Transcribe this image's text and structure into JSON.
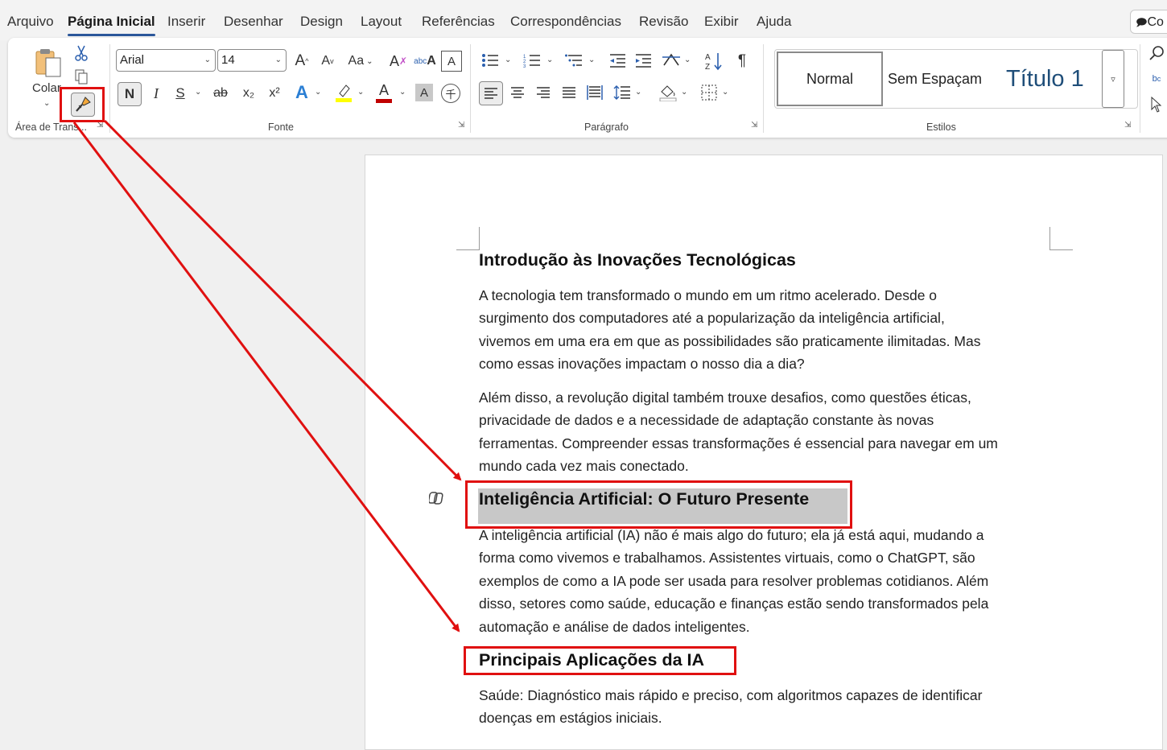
{
  "menu": {
    "tabs": [
      "Arquivo",
      "Página Inicial",
      "Inserir",
      "Desenhar",
      "Design",
      "Layout",
      "Referências",
      "Correspondências",
      "Revisão",
      "Exibir",
      "Ajuda"
    ],
    "active_tab": "Página Inicial",
    "share_label": "Co"
  },
  "ribbon": {
    "clipboard": {
      "paste_label": "Colar",
      "group_label": "Área de Trans...",
      "icons": [
        "paste-icon",
        "cut-icon",
        "copy-icon",
        "format-painter-icon"
      ]
    },
    "font": {
      "font_name": "Arial",
      "font_size": "14",
      "group_label": "Fonte",
      "grow_label": "A",
      "shrink_label": "A",
      "case_label": "Aa",
      "bold_label": "N",
      "italic_label": "I",
      "underline_label": "S",
      "strike_label": "ab",
      "subscript_label": "x₂",
      "superscript_label": "x²",
      "text_effects_label": "A",
      "font_color_label": "A",
      "char_shading_label": "A",
      "highlight_color": "#ffff00",
      "font_color": "#c00000"
    },
    "paragraph": {
      "group_label": "Parágrafo",
      "show_marks_label": "¶"
    },
    "styles": {
      "group_label": "Estilos",
      "items": [
        "Normal",
        "Sem Espaçam",
        "Título 1"
      ]
    }
  },
  "document": {
    "heading1": "Introdução às Inovações Tecnológicas",
    "para1_lines": [
      "A tecnologia tem transformado o mundo em um ritmo acelerado. Desde o",
      "surgimento dos computadores até a popularização da inteligência artificial,",
      "vivemos em uma era em que as possibilidades são praticamente ilimitadas. Mas",
      "como essas inovações impactam o nosso dia a dia?"
    ],
    "para2_lines": [
      "Além disso, a revolução digital também trouxe desafios, como questões éticas,",
      "privacidade de dados e a necessidade de adaptação constante às novas",
      "ferramentas. Compreender essas transformações é essencial para navegar em um",
      "mundo cada vez mais conectado."
    ],
    "heading2": "Inteligência Artificial: O Futuro Presente",
    "para3_lines": [
      "A inteligência artificial (IA) não é mais algo do futuro; ela já está aqui, mudando a",
      "forma como vivemos e trabalhamos. Assistentes virtuais, como o ChatGPT, são",
      "exemplos de como a IA pode ser usada para resolver problemas cotidianos. Além",
      "disso, setores como saúde, educação e finanças estão sendo transformados pela",
      "automação e análise de dados inteligentes."
    ],
    "heading3": "Principais Aplicações da IA",
    "para4_lines": [
      "Saúde: Diagnóstico mais rápido e preciso, com algoritmos capazes de identificar",
      "doenças em estágios iniciais."
    ]
  },
  "colors": {
    "annotation_red": "#e01010",
    "selection_gray": "#c8c8c8",
    "accent_blue": "#2b579a",
    "title_style_blue": "#1f4e79"
  }
}
